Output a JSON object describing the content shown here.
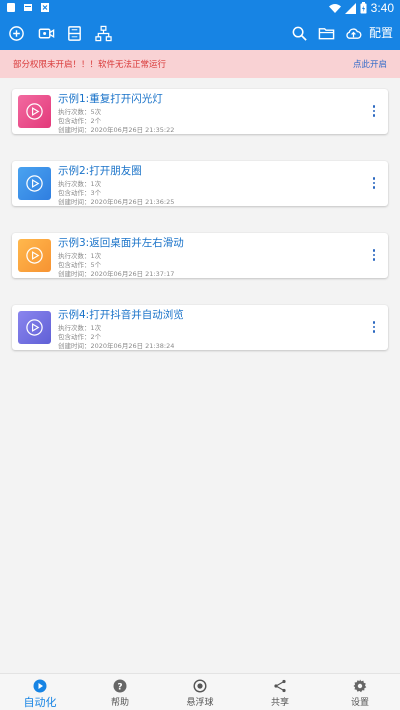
{
  "status_bar": {
    "time": "3:40"
  },
  "toolbar": {
    "config_label": "配置",
    "icons": [
      "add-circle-icon",
      "video-record-icon",
      "scan-frame-icon",
      "hierarchy-icon",
      "search-icon",
      "folder-icon",
      "cloud-upload-icon"
    ]
  },
  "banner": {
    "message": "部分权限未开启！！！软件无法正常运行",
    "action": "点此开启",
    "bg_color": "#f9d2d4",
    "text_color": "#d93a3a"
  },
  "scripts": [
    {
      "title": "示例1:重复打开闪光灯",
      "exec": "执行次数：5次",
      "actions": "包含动作：2个",
      "created": "创建时间：2020年06月26日 21:35:22",
      "color_from": "#f26aa0",
      "color_to": "#e3397a"
    },
    {
      "title": "示例2:打开朋友圈",
      "exec": "执行次数：1次",
      "actions": "包含动作：3个",
      "created": "创建时间：2020年06月26日 21:36:25",
      "color_from": "#4aa3f0",
      "color_to": "#2f7ee0"
    },
    {
      "title": "示例3:返回桌面并左右滑动",
      "exec": "执行次数：1次",
      "actions": "包含动作：5个",
      "created": "创建时间：2020年06月26日 21:37:17",
      "color_from": "#ffb84d",
      "color_to": "#f79332"
    },
    {
      "title": "示例4:打开抖音并自动浏览",
      "exec": "执行次数：1次",
      "actions": "包含动作：2个",
      "created": "创建时间：2020年06月26日 21:38:24",
      "color_from": "#8a85ee",
      "color_to": "#6060d6"
    }
  ],
  "bottom_nav": [
    {
      "label": "自动化",
      "icon": "play-circle-icon",
      "active": true
    },
    {
      "label": "帮助",
      "icon": "help-circle-icon",
      "active": false
    },
    {
      "label": "悬浮球",
      "icon": "floating-ball-icon",
      "active": false
    },
    {
      "label": "共享",
      "icon": "share-icon",
      "active": false
    },
    {
      "label": "设置",
      "icon": "gear-icon",
      "active": false
    }
  ],
  "colors": {
    "primary": "#1784e4",
    "title_blue": "#1a73c9"
  }
}
